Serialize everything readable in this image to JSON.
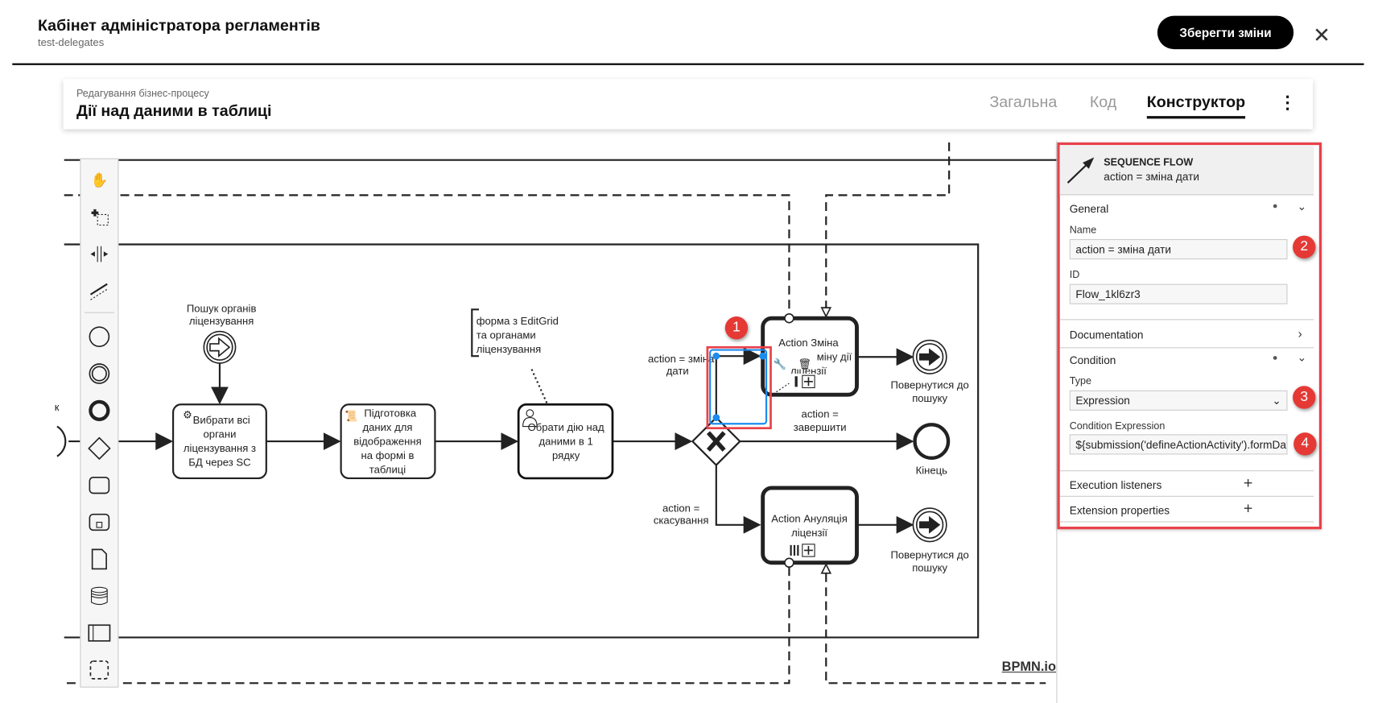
{
  "header": {
    "title": "Кабінет адміністратора регламентів",
    "subtitle": "test-delegates",
    "save_label": "Зберегти зміни",
    "close_icon": "close-icon"
  },
  "card": {
    "breadcrumb": "Редагування бізнес-процесу",
    "title": "Дії над даними в таблиці",
    "tabs": [
      {
        "label": "Загальна"
      },
      {
        "label": "Код"
      },
      {
        "label": "Конструктор"
      }
    ],
    "active_tab": "Конструктор",
    "menu_icon": "more-vertical-icon"
  },
  "palette": {
    "tools": [
      "hand-tool-icon",
      "lasso-tool-icon",
      "space-tool-icon",
      "global-connect-icon",
      "start-event-icon",
      "intermediate-event-icon",
      "end-event-icon",
      "gateway-icon",
      "task-icon",
      "subprocess-icon",
      "data-object-icon",
      "data-store-icon",
      "pool-icon",
      "group-icon"
    ]
  },
  "diagram": {
    "start_label_fragment": "к",
    "event_search": [
      "Пошук органів",
      "ліцензування"
    ],
    "task1": [
      "Вибрати всі",
      "органи",
      "ліцензування з",
      "БД через SC"
    ],
    "task2": [
      "Підготовка",
      "даних для",
      "відображення",
      "на формі в",
      "таблиці"
    ],
    "task3": [
      "Обрати дію над",
      "даними в 1",
      "рядку"
    ],
    "annotation": [
      "форма з EditGrid",
      "та органами",
      "ліцензування"
    ],
    "flow_change": [
      "action = зміна",
      "дати"
    ],
    "flow_finish": [
      "action =",
      "завершити"
    ],
    "flow_cancel": [
      "action =",
      "скасування"
    ],
    "task4": [
      "Action Зміна",
      "терміну дії",
      "ліцензії"
    ],
    "task5": [
      "Action Ануляція",
      "ліцензії"
    ],
    "end_return1": [
      "Повернутися до",
      "пошуку"
    ],
    "end_return2": [
      "Повернутися до",
      "пошуку"
    ],
    "end_final": "Кінець",
    "watermark": "BPMN.io"
  },
  "badges": [
    "1",
    "2",
    "3",
    "4"
  ],
  "panel": {
    "type": "SEQUENCE FLOW",
    "name": "action = зміна дати",
    "general": "General",
    "name_label": "Name",
    "name_value": "action = зміна дати",
    "id_label": "ID",
    "id_value": "Flow_1kl6zr3",
    "documentation": "Documentation",
    "condition": "Condition",
    "type_label": "Type",
    "type_value": "Expression",
    "expr_label": "Condition Expression",
    "expr_value": "${submission('defineActionActivity').formData",
    "exec_listeners": "Execution listeners",
    "ext_props": "Extension properties"
  },
  "colors": {
    "selection": "#1a8cf0",
    "highlight": "#e8424b",
    "badge": "#e53935"
  }
}
